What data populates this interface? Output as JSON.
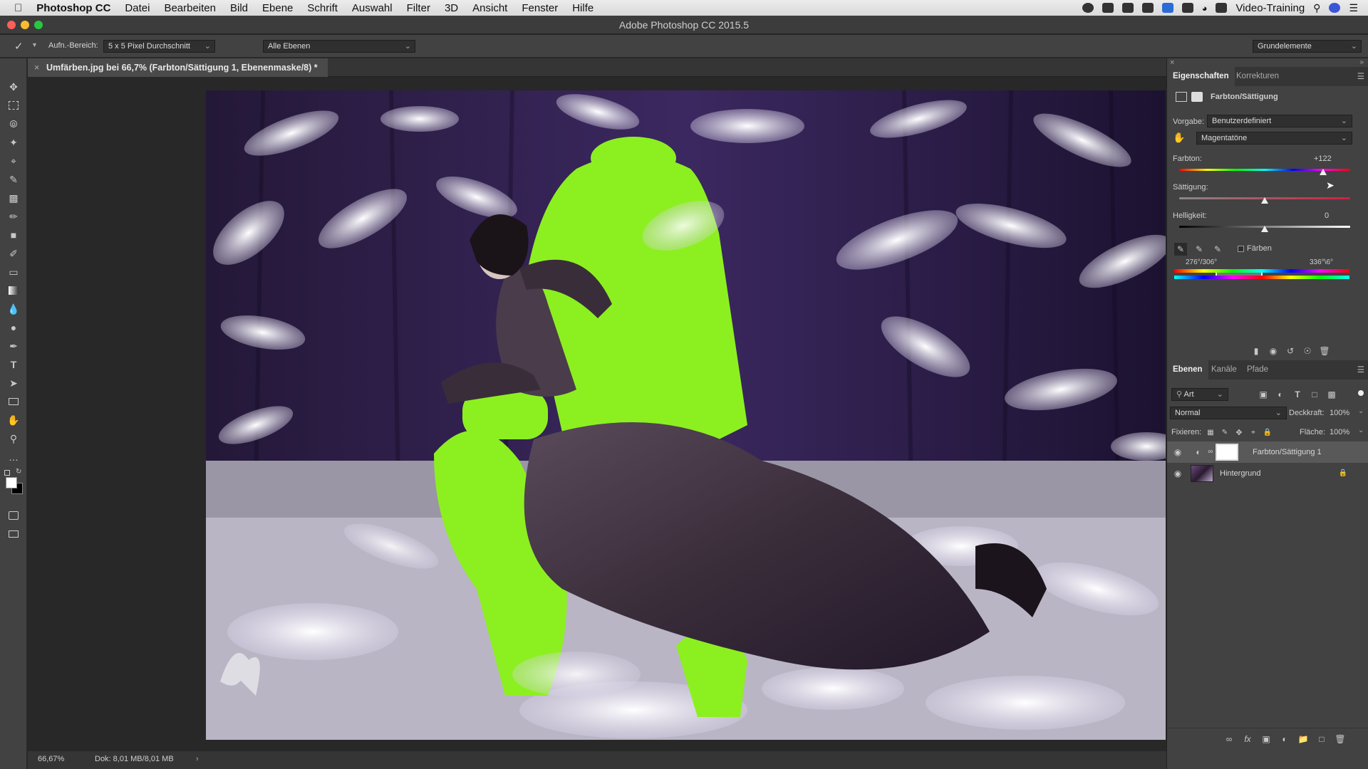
{
  "menubar": {
    "apple": "",
    "app": "Photoshop CC",
    "items": [
      "Datei",
      "Bearbeiten",
      "Bild",
      "Ebene",
      "Schrift",
      "Auswahl",
      "Filter",
      "3D",
      "Ansicht",
      "Fenster",
      "Hilfe"
    ],
    "user": "Video-Training"
  },
  "window": {
    "title": "Adobe Photoshop CC 2015.5"
  },
  "options": {
    "sample_label": "Aufn.-Bereich:",
    "sample_value": "5 x 5 Pixel Durchschnitt",
    "layers_value": "Alle Ebenen",
    "workspace": "Grundelemente"
  },
  "document": {
    "tab_title": "Umfärben.jpg bei 66,7% (Farbton/Sättigung 1, Ebenenmaske/8) *",
    "zoom": "66,67%",
    "doc_size": "Dok: 8,01 MB/8,01 MB"
  },
  "properties": {
    "tabs": [
      "Eigenschaften",
      "Korrekturen"
    ],
    "type_label": "Farbton/Sättigung",
    "preset_label": "Vorgabe:",
    "preset_value": "Benutzerdefiniert",
    "channel_value": "Magentatöne",
    "hue_label": "Farbton:",
    "hue_value": "+122",
    "hue_fraction": 0.84,
    "sat_label": "Sättigung:",
    "sat_value": "",
    "sat_fraction": 0.5,
    "light_label": "Helligkeit:",
    "light_value": "0",
    "light_fraction": 0.5,
    "colorize_label": "Färben",
    "range_left": "276°/306°",
    "range_right": "336°\\6°"
  },
  "layers": {
    "tabs": [
      "Ebenen",
      "Kanäle",
      "Pfade"
    ],
    "filter_value": "Art",
    "blend_mode": "Normal",
    "opacity_label": "Deckkraft:",
    "opacity_value": "100%",
    "lock_label": "Fixieren:",
    "fill_label": "Fläche:",
    "fill_value": "100%",
    "items": [
      {
        "name": "Farbton/Sättigung 1",
        "selected": true
      },
      {
        "name": "Hintergrund",
        "selected": false
      }
    ]
  },
  "colors": {
    "accent_green": "#8cf020",
    "dress": "#3a2d3a",
    "panel_bg": "#424242"
  }
}
